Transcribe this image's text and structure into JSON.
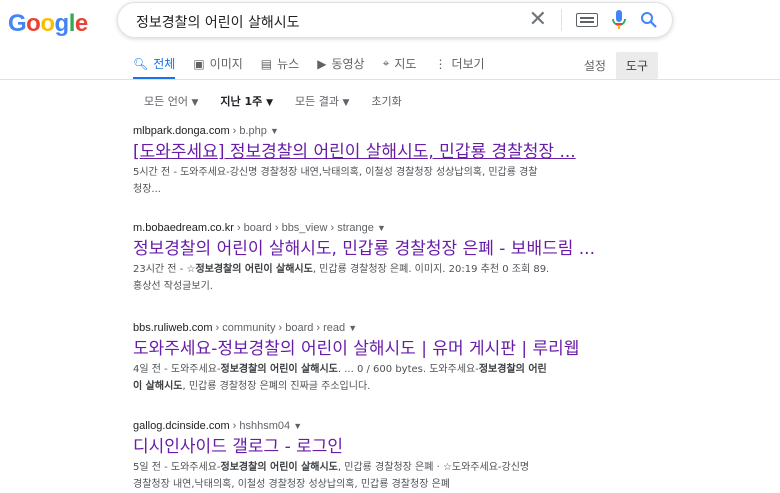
{
  "logo": {
    "l1": "G",
    "l2": "o",
    "l3": "o",
    "l4": "g",
    "l5": "l",
    "l6": "e"
  },
  "search": {
    "query": "정보경찰의 어린이 살해시도"
  },
  "tabs": [
    {
      "label": "전체",
      "icon": "search-icon",
      "active": true
    },
    {
      "label": "이미지",
      "icon": "image-icon"
    },
    {
      "label": "뉴스",
      "icon": "news-icon"
    },
    {
      "label": "동영상",
      "icon": "video-icon"
    },
    {
      "label": "지도",
      "icon": "map-pin-icon"
    },
    {
      "label": "더보기",
      "icon": "more-vert-icon"
    }
  ],
  "settings_label": "설정",
  "tools_label": "도구",
  "filters": [
    "모든 언어",
    "지난 1주",
    "모든 결과",
    "초기화"
  ],
  "results": [
    {
      "domain": "mlbpark.donga.com",
      "path": " › b.php",
      "title": "[도와주세요] 정보경찰의 어린이 살해시도, 민갑룡 경찰청장 ...",
      "snippet_pre": "5시간 전 - 도와주세요-강신명 경찰청장 내연,낙태의혹, 이철성 경찰청장 성상납의혹, 민갑룡 경찰",
      "snippet_line2": "청장..."
    },
    {
      "domain": "m.bobaedream.co.kr",
      "path": " › board › bbs_view › strange",
      "title": "정보경찰의 어린이 살해시도, 민갑룡 경찰청장 은폐 - 보배드림 ...",
      "s_a": "23시간 전 - ☆",
      "s_b": "정보경찰의 어린이 살해시도",
      "s_c": ", 민갑룡 경찰청장 은폐. 이미지. 20:19 추천 0 조회 89.",
      "s_line2": "홍상선 작성글보기."
    },
    {
      "domain": "bbs.ruliweb.com",
      "path": " › community › board › read",
      "title": "도와주세요-정보경찰의 어린이 살해시도 | 유머 게시판 | 루리웹",
      "s_a": "4일 전 - 도와주세요-",
      "s_b": "정보경찰의 어린이 살해시도",
      "s_c": ". ... 0 / 600 bytes. 도와주세요-",
      "s_d": "정보경찰의 어린",
      "s_e": "이 살해시도",
      "s_f": ", 민갑룡 경찰청장 은폐의 진짜글 주소입니다."
    },
    {
      "domain": "gallog.dcinside.com",
      "path": " › hshhsm04",
      "title": "디시인사이드 갤로그 - 로그인",
      "s_a": "5일 전 - 도와주세요-",
      "s_b": "정보경찰의 어린이 살해시도",
      "s_c": ", 민갑룡 경찰청장 은폐 · ☆도와주세요-강신명",
      "s_line2": "경찰청장 내연,낙태의혹, 이철성 경찰청장 성상납의혹, 민갑룡 경찰청장 은폐"
    }
  ]
}
